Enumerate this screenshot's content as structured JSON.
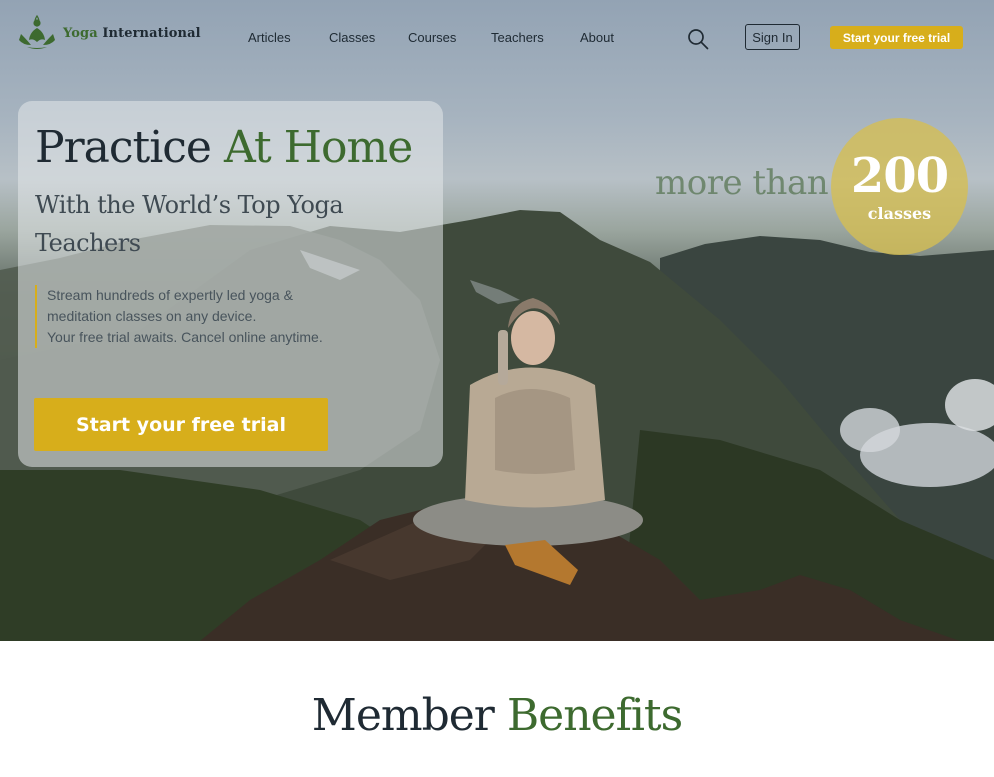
{
  "brand": {
    "name_first": "Yoga",
    "name_rest": " International",
    "logo_icon": "lotus-meditation-icon"
  },
  "nav": {
    "links": [
      "Articles",
      "Classes",
      "Courses",
      "Teachers",
      "About"
    ],
    "search_icon": "search-icon",
    "signin_label": "Sign In",
    "trial_label": "Start your free trial"
  },
  "hero": {
    "title_start": "Practice ",
    "title_accent": "At Home",
    "subtitle": "With the World’s Top Yoga Teachers",
    "description": [
      "Stream hundreds of expertly led yoga &",
      "meditation classes on any device.",
      "Your free trial awaits. Cancel online anytime."
    ],
    "cta_label": "Start your free trial"
  },
  "stat": {
    "prefix": "more than",
    "number": "200",
    "label": "classes"
  },
  "benefits": {
    "title_start": "Member ",
    "title_accent": "Benefits"
  },
  "colors": {
    "accent_gold": "#d7ae1b",
    "accent_green": "#3d6a2f",
    "text_dark": "#1f2a33"
  }
}
